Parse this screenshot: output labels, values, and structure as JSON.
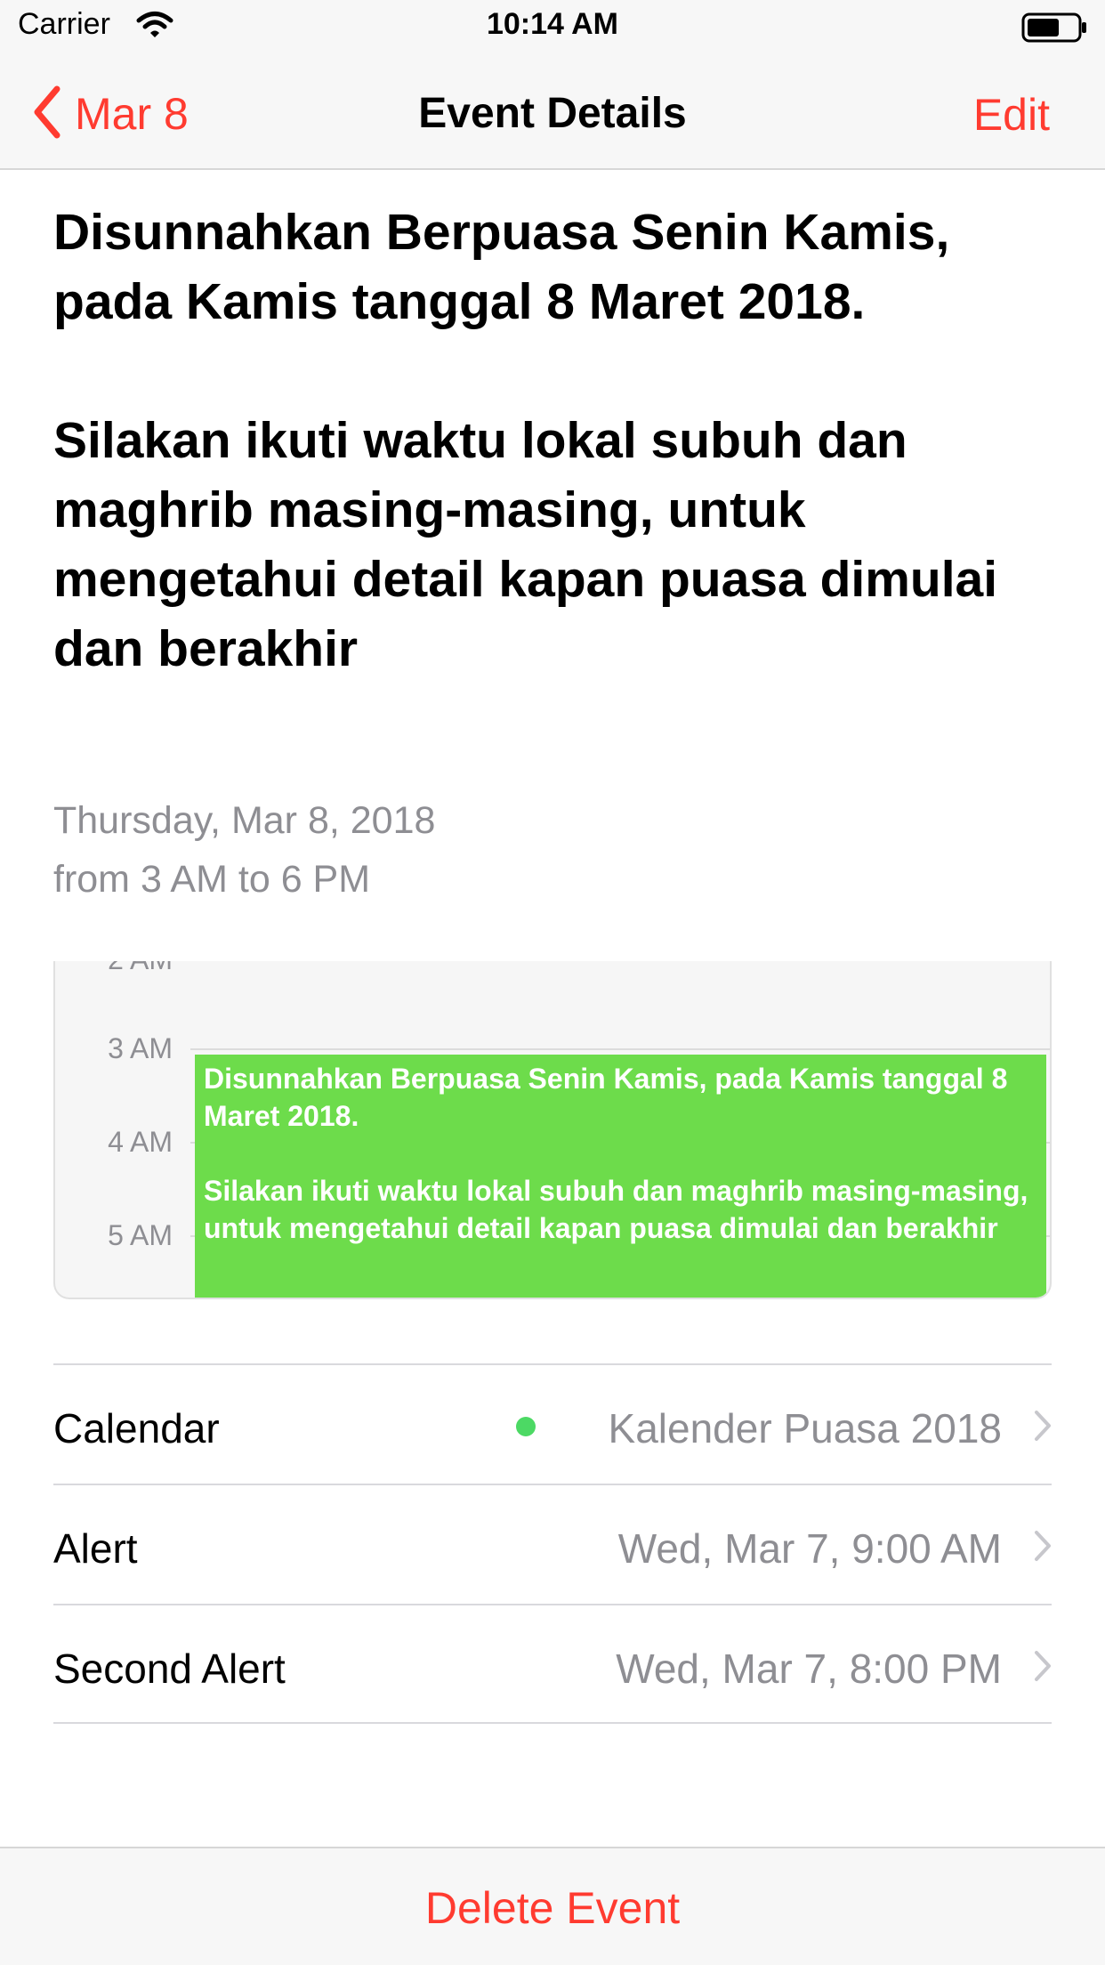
{
  "status_bar": {
    "carrier": "Carrier",
    "time": "10:14 AM"
  },
  "nav": {
    "back_label": "Mar 8",
    "title": "Event Details",
    "edit_label": "Edit"
  },
  "event": {
    "title": "Disunnahkan Berpuasa Senin Kamis, pada Kamis tanggal 8 Maret 2018.\n\nSilakan ikuti waktu lokal subuh dan maghrib masing-masing, untuk mengetahui detail kapan puasa dimulai dan berakhir",
    "date": "Thursday, Mar 8, 2018",
    "time_range": "from 3 AM to 6 PM"
  },
  "day_preview": {
    "hours": [
      "2 AM",
      "3 AM",
      "4 AM",
      "5 AM"
    ],
    "event_text": "Disunnahkan Berpuasa Senin Kamis, pada Kamis tanggal 8 Maret 2018.\n\nSilakan ikuti waktu lokal subuh dan maghrib masing-masing, untuk mengetahui detail kapan puasa dimulai dan berakhir",
    "event_color": "#6ddc4b"
  },
  "details": [
    {
      "label": "Calendar",
      "value": "Kalender Puasa 2018",
      "dot_color": "#4cd964"
    },
    {
      "label": "Alert",
      "value": "Wed, Mar 7, 9:00 AM"
    },
    {
      "label": "Second Alert",
      "value": "Wed, Mar 7, 8:00 PM"
    }
  ],
  "footer": {
    "delete_label": "Delete Event"
  },
  "colors": {
    "accent": "#ff3b30",
    "secondary_text": "#8e8e93"
  },
  "icons": {
    "back": "chevron-left-icon",
    "wifi": "wifi-icon",
    "battery": "battery-icon",
    "disclosure": "chevron-right-icon"
  }
}
